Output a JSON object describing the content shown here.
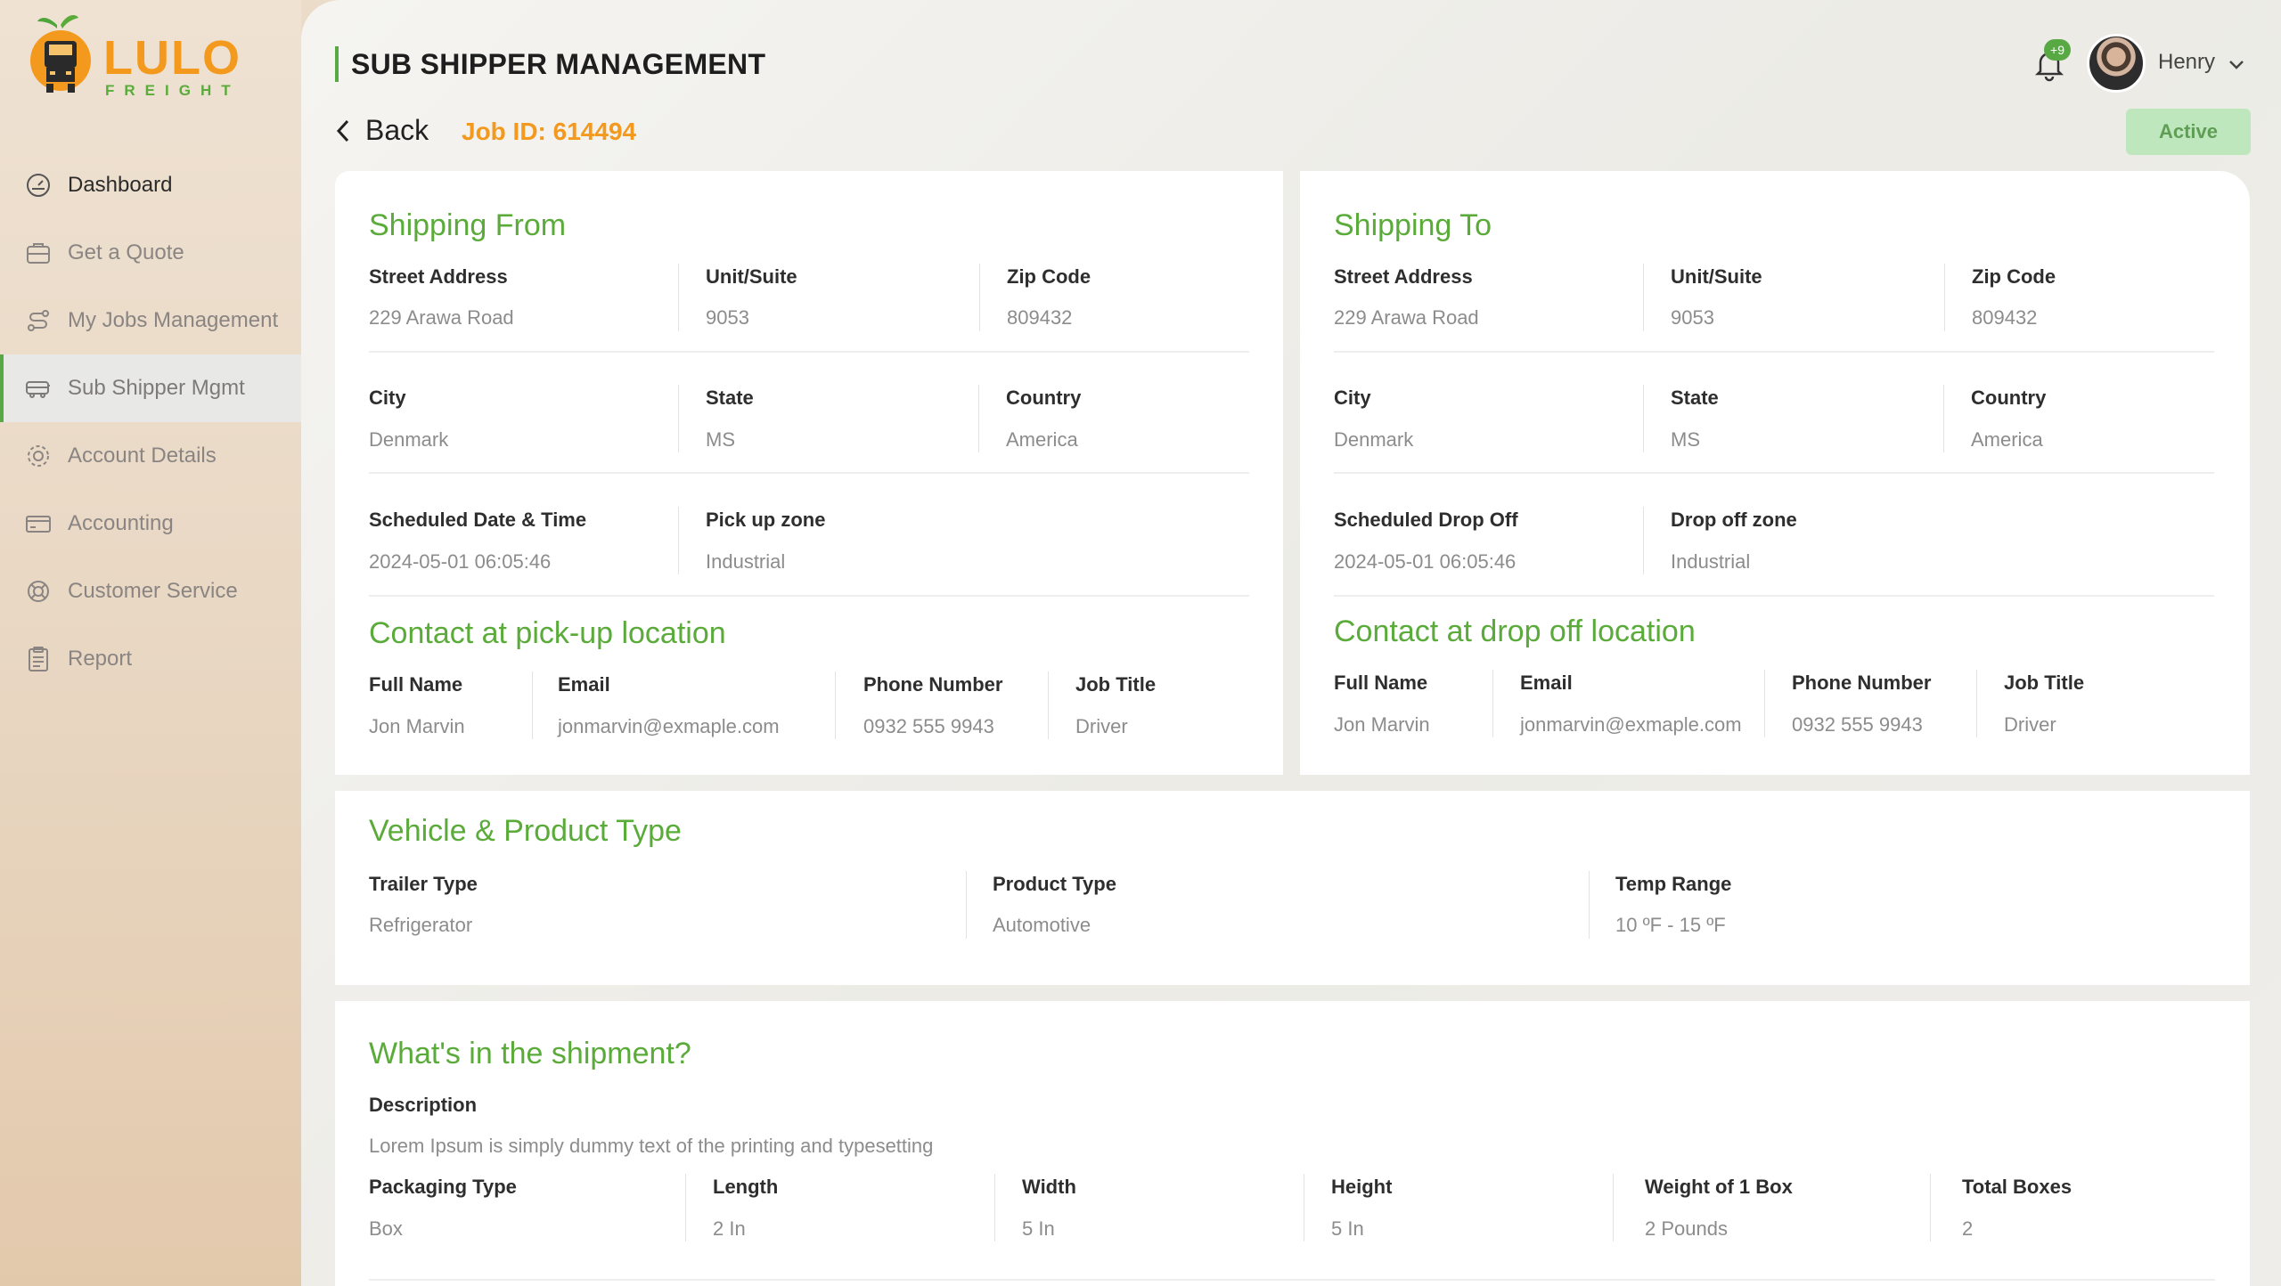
{
  "brand": {
    "name": "LULO",
    "sub": "FREIGHT"
  },
  "sidebar": {
    "items": [
      {
        "label": "Dashboard"
      },
      {
        "label": "Get a Quote"
      },
      {
        "label": "My Jobs Management"
      },
      {
        "label": "Sub Shipper Mgmt"
      },
      {
        "label": "Account Details"
      },
      {
        "label": "Accounting"
      },
      {
        "label": "Customer Service"
      },
      {
        "label": "Report"
      }
    ]
  },
  "header": {
    "title": "SUB SHIPPER MANAGEMENT",
    "notifications": "+9",
    "user": "Henry"
  },
  "subheader": {
    "back_label": "Back",
    "job_id": "Job ID: 614494",
    "status": "Active"
  },
  "shipping_from": {
    "title": "Shipping From",
    "street_label": "Street Address",
    "street": "229 Arawa Road",
    "unit_label": "Unit/Suite",
    "unit": "9053",
    "zip_label": "Zip Code",
    "zip": "809432",
    "city_label": "City",
    "city": "Denmark",
    "state_label": "State",
    "state": "MS",
    "country_label": "Country",
    "country": "America",
    "date_label": "Scheduled Date & Time",
    "date": "2024-05-01 06:05:46",
    "zone_label": "Pick up zone",
    "zone": "Industrial",
    "contact_title": "Contact at pick-up location",
    "name_label": "Full Name",
    "name": "Jon Marvin",
    "email_label": "Email",
    "email": "jonmarvin@exmaple.com",
    "phone_label": "Phone Number",
    "phone": "0932 555 9943",
    "job_label": "Job Title",
    "job": "Driver"
  },
  "shipping_to": {
    "title": "Shipping To",
    "street_label": "Street Address",
    "street": "229 Arawa Road",
    "unit_label": "Unit/Suite",
    "unit": "9053",
    "zip_label": "Zip Code",
    "zip": "809432",
    "city_label": "City",
    "city": "Denmark",
    "state_label": "State",
    "state": "MS",
    "country_label": "Country",
    "country": "America",
    "date_label": "Scheduled Drop Off",
    "date": "2024-05-01 06:05:46",
    "zone_label": "Drop off zone",
    "zone": "Industrial",
    "contact_title": "Contact at drop off location",
    "name_label": "Full Name",
    "name": "Jon Marvin",
    "email_label": "Email",
    "email": "jonmarvin@exmaple.com",
    "phone_label": "Phone Number",
    "phone": "0932 555 9943",
    "job_label": "Job Title",
    "job": "Driver"
  },
  "vehicle": {
    "title": "Vehicle & Product Type",
    "trailer_label": "Trailer Type",
    "trailer": "Refrigerator",
    "product_label": "Product Type",
    "product": "Automotive",
    "temp_label": "Temp Range",
    "temp": "10 ºF - 15 ºF"
  },
  "shipment": {
    "title": "What's in the shipment?",
    "desc_label": "Description",
    "desc": "Lorem Ipsum is simply dummy text of the printing and typesetting",
    "packaging_label": "Packaging Type",
    "packaging": "Box",
    "length_label": "Length",
    "length": "2 In",
    "width_label": "Width",
    "width": "5 In",
    "height_label": "Height",
    "height": "5 In",
    "weight_label": "Weight of 1 Box",
    "weight": "2 Pounds",
    "boxes_label": "Total Boxes",
    "boxes": "2"
  },
  "colors": {
    "accent": "#5aab3a",
    "brand_orange": "#f39a1e",
    "status_bg": "#bfe7be"
  }
}
